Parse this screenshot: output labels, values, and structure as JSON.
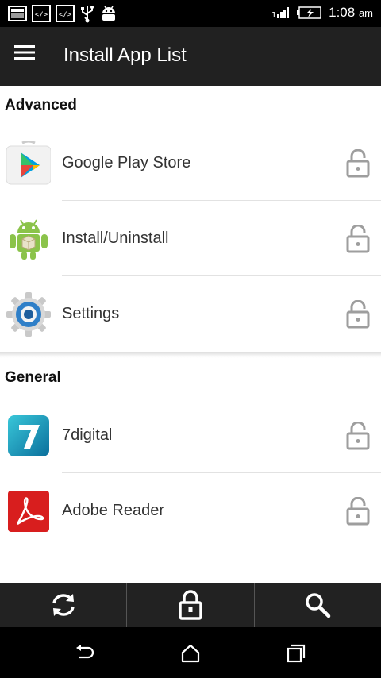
{
  "status_bar": {
    "time": "1:08",
    "ampm": "am",
    "icons": [
      "image-icon",
      "code-icon",
      "code-icon",
      "usb-icon",
      "android-debug-icon",
      "signal-icon",
      "battery-charging-icon"
    ]
  },
  "toolbar": {
    "title": "Install App List",
    "menu_icon": "menu-icon"
  },
  "sections": [
    {
      "title": "Advanced",
      "items": [
        {
          "label": "Google Play Store",
          "icon": "google-play-icon",
          "locked": false
        },
        {
          "label": "Install/Uninstall",
          "icon": "android-package-icon",
          "locked": false
        },
        {
          "label": "Settings",
          "icon": "settings-gear-icon",
          "locked": false
        }
      ]
    },
    {
      "title": "General",
      "items": [
        {
          "label": "7digital",
          "icon": "7digital-icon",
          "locked": false
        },
        {
          "label": "Adobe Reader",
          "icon": "adobe-reader-icon",
          "locked": false
        }
      ]
    }
  ],
  "action_bar": {
    "buttons": [
      "refresh-icon",
      "lock-icon",
      "search-icon"
    ]
  },
  "nav_bar": {
    "buttons": [
      "back-icon",
      "home-icon",
      "recents-icon"
    ]
  },
  "colors": {
    "toolbar": "#212121",
    "action_bar": "#222222",
    "lock_icon": "#9e9e9e"
  }
}
